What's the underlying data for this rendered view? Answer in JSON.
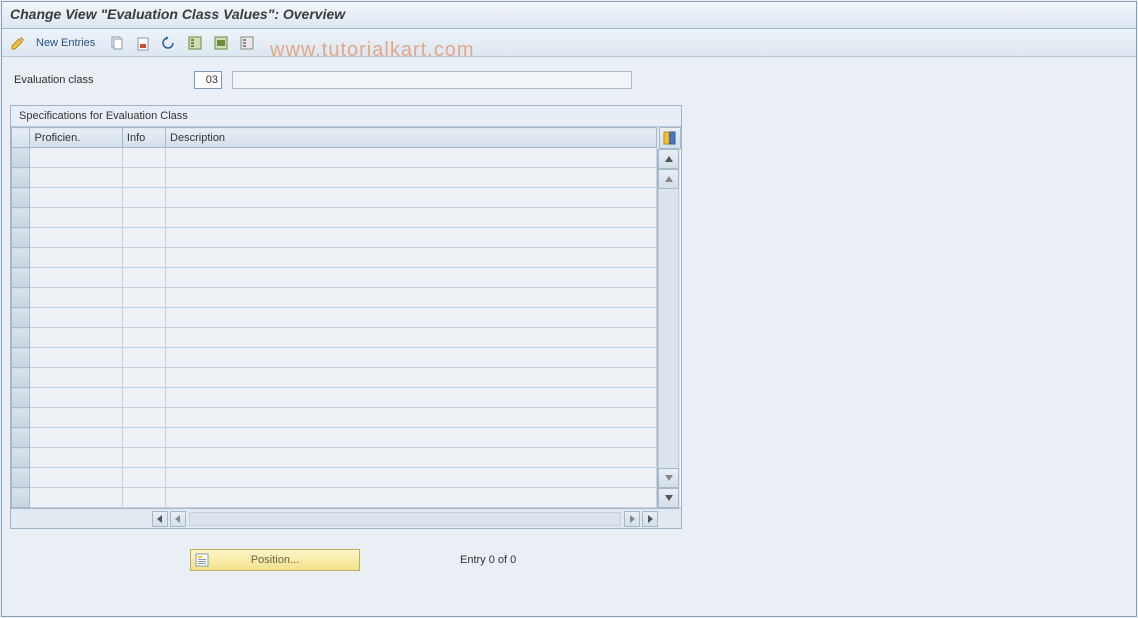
{
  "title": "Change View \"Evaluation Class Values\": Overview",
  "toolbar": {
    "new_entries": "New Entries"
  },
  "field": {
    "label": "Evaluation class",
    "value": "03",
    "desc": ""
  },
  "panel": {
    "title": "Specifications for Evaluation Class",
    "columns": {
      "proficien": "Proficien.",
      "info": "Info",
      "description": "Description"
    },
    "rows": [
      {
        "proficien": "",
        "info": "",
        "description": ""
      },
      {
        "proficien": "",
        "info": "",
        "description": ""
      },
      {
        "proficien": "",
        "info": "",
        "description": ""
      },
      {
        "proficien": "",
        "info": "",
        "description": ""
      },
      {
        "proficien": "",
        "info": "",
        "description": ""
      },
      {
        "proficien": "",
        "info": "",
        "description": ""
      },
      {
        "proficien": "",
        "info": "",
        "description": ""
      },
      {
        "proficien": "",
        "info": "",
        "description": ""
      },
      {
        "proficien": "",
        "info": "",
        "description": ""
      },
      {
        "proficien": "",
        "info": "",
        "description": ""
      },
      {
        "proficien": "",
        "info": "",
        "description": ""
      },
      {
        "proficien": "",
        "info": "",
        "description": ""
      },
      {
        "proficien": "",
        "info": "",
        "description": ""
      },
      {
        "proficien": "",
        "info": "",
        "description": ""
      },
      {
        "proficien": "",
        "info": "",
        "description": ""
      },
      {
        "proficien": "",
        "info": "",
        "description": ""
      },
      {
        "proficien": "",
        "info": "",
        "description": ""
      },
      {
        "proficien": "",
        "info": "",
        "description": ""
      }
    ]
  },
  "footer": {
    "position_btn": "Position...",
    "entry_text": "Entry 0 of 0"
  },
  "watermark": "www.tutorialkart.com"
}
